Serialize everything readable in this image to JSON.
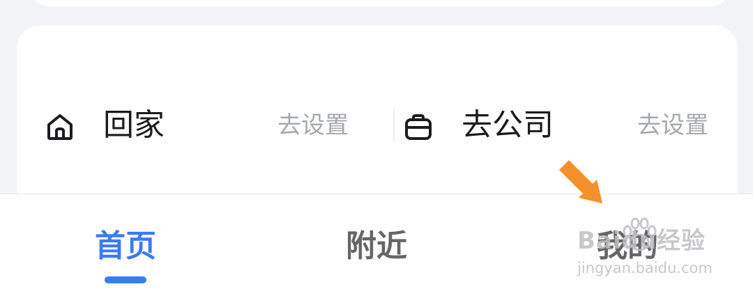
{
  "commute": {
    "home": {
      "label": "回家",
      "action": "去设置",
      "icon": "home-icon"
    },
    "work": {
      "label": "去公司",
      "action": "去设置",
      "icon": "briefcase-icon"
    }
  },
  "tabs": [
    {
      "label": "首页",
      "active": true
    },
    {
      "label": "附近",
      "active": false
    },
    {
      "label": "我的",
      "active": false
    }
  ],
  "annotation": {
    "icon": "arrow-icon",
    "color": "#f5902c"
  },
  "watermark": {
    "brand": "Baidu经验",
    "url": "jingyan.baidu.com",
    "icon": "paw-icon"
  },
  "colors": {
    "accent": "#3a7bf0",
    "muted": "#a6a8ad",
    "text": "#1c1c1e",
    "arrow": "#f5902c"
  }
}
